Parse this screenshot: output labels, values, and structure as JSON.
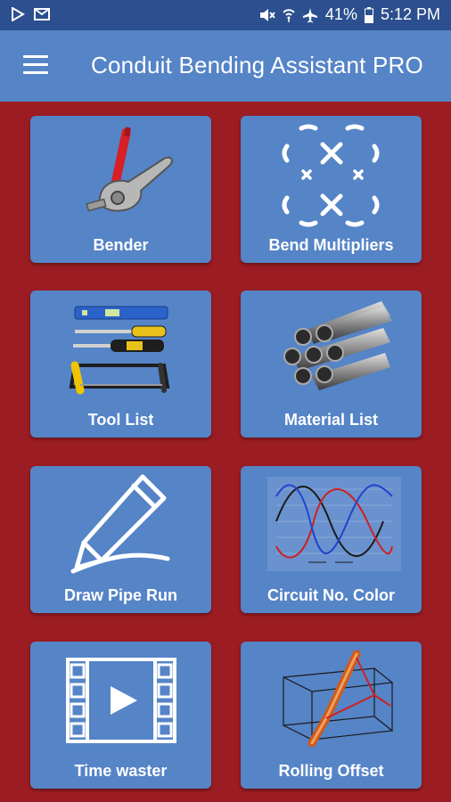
{
  "status_bar": {
    "battery": "41%",
    "time": "5:12 PM",
    "icons": [
      "play-store-icon",
      "mail-icon",
      "mute-icon",
      "wifi-icon",
      "airplane-icon",
      "battery-icon"
    ]
  },
  "app_bar": {
    "title": "Conduit Bending Assistant PRO",
    "menu_icon": "hamburger-menu-icon"
  },
  "colors": {
    "status_bar": "#2b4f8f",
    "app_bar": "#5584c7",
    "tile": "#5584c7",
    "background": "#9b1c22"
  },
  "tiles": [
    {
      "label": "Bender",
      "icon": "bender-icon"
    },
    {
      "label": "Bend Multipliers",
      "icon": "bend-multipliers-icon"
    },
    {
      "label": "Tool List",
      "icon": "tools-icon"
    },
    {
      "label": "Material List",
      "icon": "pipes-icon"
    },
    {
      "label": "Draw Pipe Run",
      "icon": "pencil-icon"
    },
    {
      "label": "Circuit No. Color",
      "icon": "sine-waves-icon"
    },
    {
      "label": "Time waster",
      "icon": "video-icon"
    },
    {
      "label": "Rolling Offset",
      "icon": "rolling-offset-icon"
    }
  ]
}
